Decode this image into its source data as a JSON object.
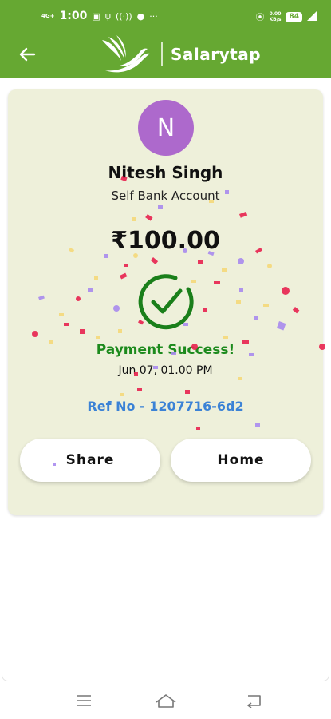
{
  "status_bar": {
    "network_label": "4G+",
    "time": "1:00",
    "speed_value": "0.00",
    "speed_unit": "KB/s",
    "battery": "84"
  },
  "app_bar": {
    "brand_name": "Salarytap"
  },
  "receipt": {
    "avatar_initial": "N",
    "recipient_name": "Nitesh Singh",
    "account_type": "Self Bank Account",
    "amount": "₹100.00",
    "status": "Payment Success!",
    "datetime": "Jun 07, 01.00 PM",
    "reference": "Ref No - 1207716-6d2"
  },
  "actions": {
    "share_label": "Share",
    "home_label": "Home"
  },
  "colors": {
    "header_green": "#66a832",
    "card_bg": "#eef0da",
    "avatar_purple": "#ad69cc",
    "success_green": "#1c8a1c",
    "ref_blue": "#3b82d6"
  },
  "icons": {
    "back": "arrow-left-icon",
    "logo": "bird-logo-icon",
    "success": "check-circle-icon",
    "nav_menu": "menu-icon",
    "nav_home": "home-icon",
    "nav_back": "back-icon"
  }
}
